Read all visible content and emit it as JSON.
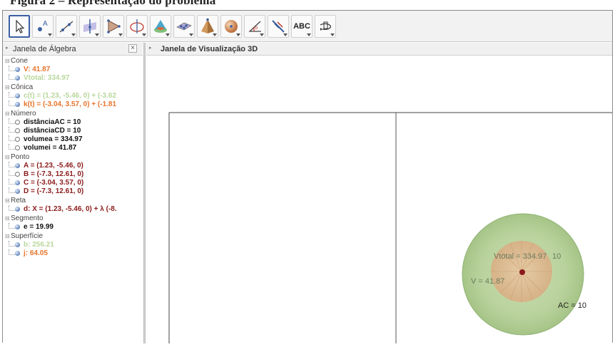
{
  "caption": "Figura 2 – Representação do problema",
  "toolbar": {
    "tools": [
      {
        "icon": "move-arrow-icon",
        "active": true
      },
      {
        "icon": "point-icon"
      },
      {
        "icon": "line-icon"
      },
      {
        "icon": "perpendicular-line-icon"
      },
      {
        "icon": "polygon-icon"
      },
      {
        "icon": "circle-axis-icon"
      },
      {
        "icon": "intersect-surfaces-icon"
      },
      {
        "icon": "plane-icon"
      },
      {
        "icon": "pyramid-icon"
      },
      {
        "icon": "sphere-icon"
      },
      {
        "icon": "angle-icon"
      },
      {
        "icon": "reflect-icon"
      },
      {
        "icon": "text-icon",
        "label": "ABC"
      },
      {
        "icon": "rotate-view-icon"
      }
    ]
  },
  "algebra": {
    "title": "Janela de Álgebra",
    "close": "×",
    "categories": [
      {
        "name": "Cone",
        "items": [
          {
            "text": "V: 41.87",
            "color": "#e8742a",
            "visible": true
          },
          {
            "text": "Vtotal: 334.97",
            "color": "#b9d79c",
            "visible": true
          }
        ]
      },
      {
        "name": "Cônica",
        "items": [
          {
            "text": "c(t) = (1.23, -5.46, 0) + (-3.62",
            "color": "#b9d79c",
            "visible": true
          },
          {
            "text": "k(t) = (-3.04, 3.57, 0) + (-1.81",
            "color": "#e8742a",
            "visible": true
          }
        ]
      },
      {
        "name": "Número",
        "items": [
          {
            "text": "distânciaAC = 10",
            "color": "#111111",
            "visible": false
          },
          {
            "text": "distânciaCD = 10",
            "color": "#111111",
            "visible": false
          },
          {
            "text": "volumea = 334.97",
            "color": "#111111",
            "visible": false
          },
          {
            "text": "volumei = 41.87",
            "color": "#111111",
            "visible": false
          }
        ]
      },
      {
        "name": "Ponto",
        "items": [
          {
            "text": "A = (1.23, -5.46, 0)",
            "color": "#8b1a1a",
            "visible": true
          },
          {
            "text": "B = (-7.3, 12.61, 0)",
            "color": "#8b1a1a",
            "visible": false
          },
          {
            "text": "C = (-3.04, 3.57, 0)",
            "color": "#8b1a1a",
            "visible": true
          },
          {
            "text": "D = (-7.3, 12.61, 0)",
            "color": "#8b1a1a",
            "visible": true
          }
        ]
      },
      {
        "name": "Reta",
        "items": [
          {
            "text": "d: X = (1.23, -5.46, 0) + λ (-8.",
            "color": "#8b1a1a",
            "visible": true
          }
        ]
      },
      {
        "name": "Segmento",
        "items": [
          {
            "text": "e = 19.99",
            "color": "#111111",
            "visible": true
          }
        ]
      },
      {
        "name": "Superfície",
        "items": [
          {
            "text": "b: 256.21",
            "color": "#b9d79c",
            "visible": true
          },
          {
            "text": "j: 64.05",
            "color": "#e8742a",
            "visible": true
          }
        ]
      }
    ]
  },
  "view3d": {
    "title": "Janela de Visualização 3D",
    "labels": {
      "vtotal": "Vtotal = 334.97",
      "ten_a": "10",
      "v": "V = 41.87",
      "ac": "AC = 10"
    }
  },
  "colors": {
    "accent": "#3b5fa3",
    "outer_cone": "#b9d79c",
    "inner_cone": "#e0b88f",
    "point": "#8b1a1a"
  }
}
